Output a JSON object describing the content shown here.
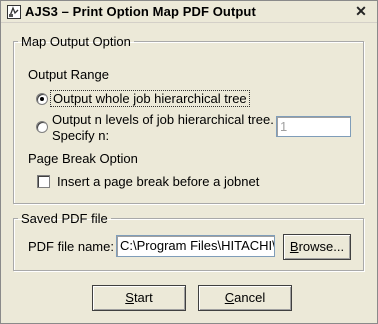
{
  "window": {
    "title": "AJS3 – Print Option Map PDF Output",
    "close_glyph": "✕"
  },
  "map_output": {
    "legend": "Map Output Option",
    "output_range_label": "Output Range",
    "radio_whole": "Output whole job hierarchical tree",
    "radio_levels_line1": "Output n levels of job hierarchical tree.",
    "radio_levels_line2": "Specify n:",
    "levels_value": "1",
    "selected_range": "whole",
    "page_break_label": "Page Break Option",
    "page_break_checkbox": "Insert a page break before a jobnet",
    "page_break_checked": false
  },
  "saved_pdf": {
    "legend": "Saved PDF file",
    "file_name_label": "PDF file name:",
    "file_name_value": "C:\\Program Files\\HITACHI\\J",
    "browse_pre": "",
    "browse_mnemonic": "B",
    "browse_post": "rowse..."
  },
  "buttons": {
    "start_mnemonic": "S",
    "start_post": "tart",
    "cancel_mnemonic": "C",
    "cancel_post": "ancel"
  },
  "icons": {
    "app_icon": "app-icon",
    "close_icon": "close-icon"
  }
}
